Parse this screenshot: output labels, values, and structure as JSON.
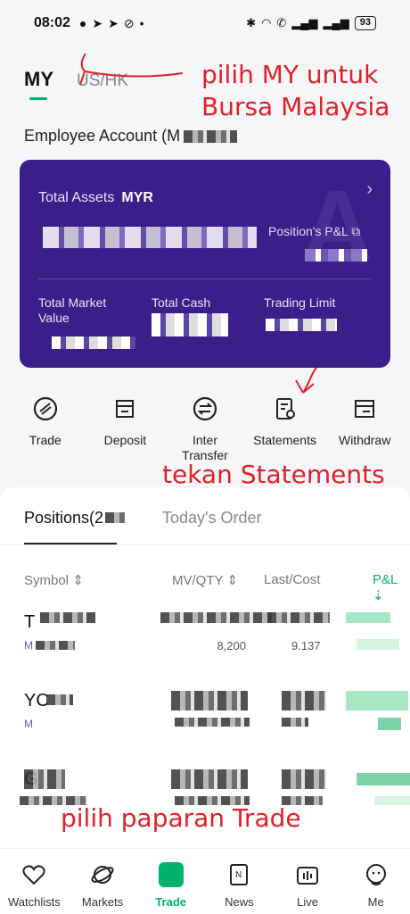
{
  "status": {
    "time": "08:02",
    "battery": "93"
  },
  "market_tabs": {
    "my": "MY",
    "ushk": "US/HK"
  },
  "annotations": {
    "choose_my": "pilih MY untuk Bursa Malaysia",
    "press_statements": "tekan Statements",
    "choose_trade": "pilih paparan Trade"
  },
  "account": {
    "label": "Employee Account (M"
  },
  "card": {
    "total_assets_label": "Total Assets",
    "currency": "MYR",
    "positions_pnl_label": "Position's P&L",
    "total_market_value_label": "Total Market Value",
    "total_cash_label": "Total Cash",
    "trading_limit_label": "Trading Limit"
  },
  "actions": [
    {
      "label": "Trade",
      "icon": "trade-icon"
    },
    {
      "label": "Deposit",
      "icon": "deposit-icon"
    },
    {
      "label": "Inter Transfer",
      "icon": "transfer-icon"
    },
    {
      "label": "Statements",
      "icon": "statements-icon"
    },
    {
      "label": "Withdraw",
      "icon": "withdraw-icon"
    }
  ],
  "positions": {
    "tab_positions": "Positions(2",
    "tab_orders": "Today's Order",
    "col_symbol": "Symbol",
    "col_mv": "MV/QTY",
    "col_last": "Last/Cost",
    "col_pnl": "P&L",
    "rows": [
      {
        "symbol": "T",
        "sub": "M",
        "qty": "8,200",
        "cost": "9.137"
      },
      {
        "symbol": "YC",
        "sub": "M",
        "qty": "",
        "cost": ""
      },
      {
        "symbol": "G",
        "sub": "",
        "qty": "",
        "cost": ""
      }
    ]
  },
  "nav": [
    {
      "label": "Watchlists",
      "icon": "heart-icon"
    },
    {
      "label": "Markets",
      "icon": "planet-icon"
    },
    {
      "label": "Trade",
      "icon": "trade-nav-icon"
    },
    {
      "label": "News",
      "icon": "news-icon"
    },
    {
      "label": "Live",
      "icon": "live-icon"
    },
    {
      "label": "Me",
      "icon": "profile-icon"
    }
  ],
  "colors": {
    "accent": "#00b36b",
    "card": "#3b1e8a",
    "annotation": "#e0202a"
  }
}
